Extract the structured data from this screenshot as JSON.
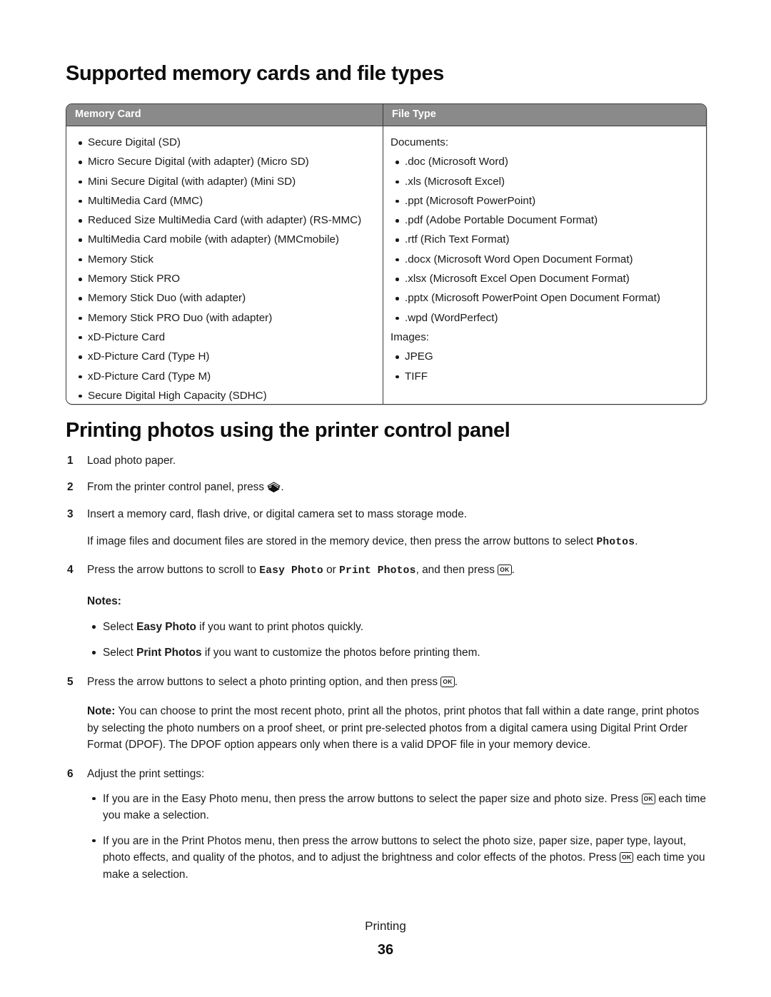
{
  "page": {
    "chapter_label": "Printing",
    "page_number": "36"
  },
  "section1": {
    "title": "Supported memory cards and file types",
    "table": {
      "headers": {
        "memory_card": "Memory Card",
        "file_type": "File Type"
      },
      "memory_cards": [
        "Secure Digital (SD)",
        "Micro Secure Digital (with adapter) (Micro SD)",
        "Mini Secure Digital (with adapter) (Mini SD)",
        "MultiMedia Card (MMC)",
        "Reduced Size MultiMedia Card (with adapter) (RS-MMC)",
        "MultiMedia Card mobile (with adapter) (MMCmobile)",
        "Memory Stick",
        "Memory Stick PRO",
        "Memory Stick Duo (with adapter)",
        "Memory Stick PRO Duo (with adapter)",
        "xD-Picture Card",
        "xD-Picture Card (Type H)",
        "xD-Picture Card (Type M)",
        "Secure Digital High Capacity (SDHC)"
      ],
      "file_types": {
        "documents_label": "Documents:",
        "documents": [
          ".doc (Microsoft Word)",
          ".xls (Microsoft Excel)",
          ".ppt (Microsoft PowerPoint)",
          ".pdf (Adobe Portable Document Format)",
          ".rtf (Rich Text Format)",
          ".docx (Microsoft Word Open Document Format)",
          ".xlsx (Microsoft Excel Open Document Format)",
          ".pptx (Microsoft PowerPoint Open Document Format)",
          ".wpd (WordPerfect)"
        ],
        "images_label": "Images:",
        "images": [
          "JPEG",
          "TIFF"
        ]
      }
    }
  },
  "section2": {
    "title": "Printing photos using the printer control panel",
    "steps": {
      "s1_num": "1",
      "s1_text": "Load photo paper.",
      "s2_num": "2",
      "s2_text_before": "From the printer control panel, press ",
      "s2_icon_name": "photo-card-stack-icon",
      "s2_text_after": ".",
      "s3_num": "3",
      "s3_text": "Insert a memory card, flash drive, or digital camera set to mass storage mode.",
      "s3_sub_before": "If image files and document files are stored in the memory device, then press the arrow buttons to select ",
      "s3_sub_mono": "Photos",
      "s3_sub_after": ".",
      "s4_num": "4",
      "s4_a": "Press the arrow buttons to scroll to ",
      "s4_mono1": "Easy Photo",
      "s4_b": " or ",
      "s4_mono2": "Print Photos",
      "s4_c": ", and then press ",
      "s4_ok": "OK",
      "s4_d": ".",
      "notes_label": "Notes:",
      "note1_a": "Select ",
      "note1_bold": "Easy Photo",
      "note1_b": " if you want to print photos quickly.",
      "note2_a": "Select ",
      "note2_bold": "Print Photos",
      "note2_b": " if you want to customize the photos before printing them.",
      "s5_num": "5",
      "s5_a": "Press the arrow buttons to select a photo printing option, and then press ",
      "s5_ok": "OK",
      "s5_b": ".",
      "note_label": "Note:",
      "note_body": " You can choose to print the most recent photo, print all the photos, print photos that fall within a date range, print photos by selecting the photo numbers on a proof sheet, or print pre-selected photos from a digital camera using Digital Print Order Format (DPOF). The DPOF option appears only when there is a valid DPOF file in your memory device.",
      "s6_num": "6",
      "s6_text": "Adjust the print settings:",
      "s6_b1_a": "If you are in the Easy Photo menu, then press the arrow buttons to select the paper size and photo size. Press ",
      "s6_b1_ok": "OK",
      "s6_b1_b": " each time you make a selection.",
      "s6_b2_a": "If you are in the Print Photos menu, then press the arrow buttons to select the photo size, paper size, paper type, layout, photo effects, and quality of the photos, and to adjust the brightness and color effects of the photos. Press ",
      "s6_b2_ok": "OK",
      "s6_b2_b": " each time you make a selection."
    }
  },
  "colors": {
    "table_header_bg": "#8a8a8a",
    "table_border": "#3a3a3a",
    "text": "#1a1a1a",
    "page_bg": "#ffffff"
  }
}
